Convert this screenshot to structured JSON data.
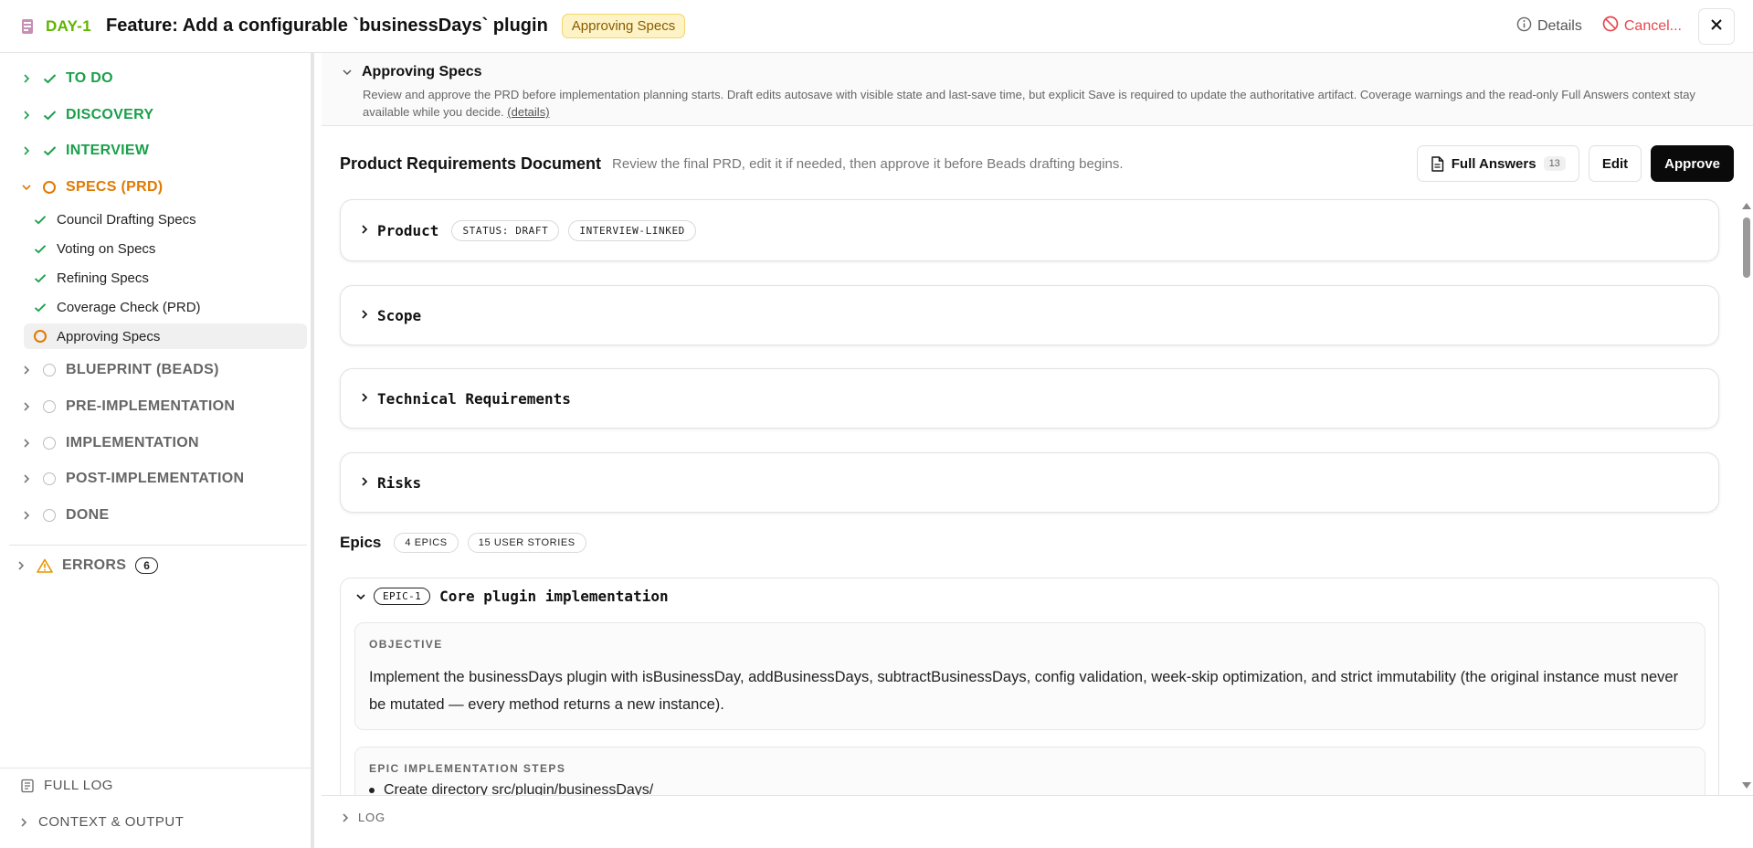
{
  "header": {
    "ticket": "DAY-1",
    "title": "Feature: Add a configurable `businessDays` plugin",
    "status_badge": "Approving Specs",
    "details_label": "Details",
    "cancel_label": "Cancel..."
  },
  "sidebar": {
    "phases_top": [
      {
        "label": "TO DO"
      },
      {
        "label": "DISCOVERY"
      },
      {
        "label": "INTERVIEW"
      }
    ],
    "active_phase": {
      "label": "SPECS (PRD)"
    },
    "substeps": [
      {
        "label": "Council Drafting Specs"
      },
      {
        "label": "Voting on Specs"
      },
      {
        "label": "Refining Specs"
      },
      {
        "label": "Coverage Check (PRD)"
      },
      {
        "label": "Approving Specs"
      }
    ],
    "phases_pending": [
      {
        "label": "BLUEPRINT (BEADS)"
      },
      {
        "label": "PRE-IMPLEMENTATION"
      },
      {
        "label": "IMPLEMENTATION"
      },
      {
        "label": "POST-IMPLEMENTATION"
      },
      {
        "label": "DONE"
      }
    ],
    "errors": {
      "label": "ERRORS",
      "count": "6"
    },
    "full_log_label": "FULL LOG",
    "context_output_label": "CONTEXT & OUTPUT"
  },
  "stage": {
    "title": "Approving Specs",
    "description": "Review and approve the PRD before implementation planning starts. Draft edits autosave with visible state and last-save time, but explicit Save is required to update the authoritative artifact. Coverage warnings and the read-only Full Answers context stay available while you decide.",
    "details_link": "(details)"
  },
  "document": {
    "title": "Product Requirements Document",
    "subtitle": "Review the final PRD, edit it if needed, then approve it before Beads drafting begins.",
    "full_answers_label": "Full Answers",
    "full_answers_count": "13",
    "edit_label": "Edit",
    "approve_label": "Approve",
    "sections": [
      {
        "name": "Product",
        "tags": [
          "STATUS: DRAFT",
          "INTERVIEW-LINKED"
        ]
      },
      {
        "name": "Scope"
      },
      {
        "name": "Technical Requirements"
      },
      {
        "name": "Risks"
      }
    ]
  },
  "epics": {
    "label": "Epics",
    "epic_count": "4 EPICS",
    "story_count": "15 USER STORIES",
    "items": [
      {
        "id": "EPIC-1",
        "name": "Core plugin implementation",
        "objective_label": "OBJECTIVE",
        "objective": "Implement the businessDays plugin with isBusinessDay, addBusinessDays, subtractBusinessDays, config validation, week-skip optimization, and strict immutability (the original instance must never be mutated — every method returns a new instance).",
        "steps_label": "EPIC IMPLEMENTATION STEPS",
        "first_step": "Create directory src/plugin/businessDays/"
      }
    ]
  },
  "log": {
    "label": "LOG"
  },
  "colors": {
    "done": "#19a04a",
    "active": "#e07a00",
    "ticket": "#5fb400",
    "danger": "#e5484d",
    "badge_bg": "#fdf3c6"
  }
}
